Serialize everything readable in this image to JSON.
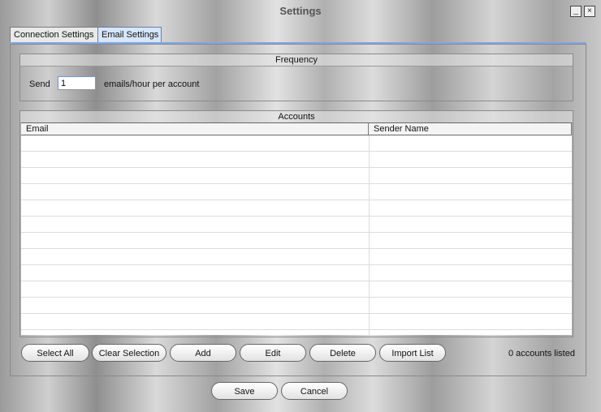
{
  "window": {
    "title": "Settings",
    "minimize_glyph": "_",
    "close_glyph": "×"
  },
  "tabs": [
    {
      "label": "Connection Settings",
      "active": false
    },
    {
      "label": "Email Settings",
      "active": true
    }
  ],
  "frequency": {
    "group_title": "Frequency",
    "send_label": "Send",
    "value": "1",
    "suffix": "emails/hour per account"
  },
  "accounts": {
    "group_title": "Accounts",
    "columns": [
      "Email",
      "Sender Name"
    ],
    "rows": []
  },
  "actions": {
    "select_all": "Select All",
    "clear_selection": "Clear Selection",
    "add": "Add",
    "edit": "Edit",
    "delete": "Delete",
    "import_list": "Import List",
    "status": "0 accounts listed"
  },
  "footer": {
    "save": "Save",
    "cancel": "Cancel"
  },
  "colors": {
    "active_tab_bg": "#d6e6fb",
    "tab_accent": "#7fa6e6",
    "input_border": "#7a96c8"
  },
  "icons": {
    "minimize": "minimize-icon",
    "close": "close-icon"
  }
}
